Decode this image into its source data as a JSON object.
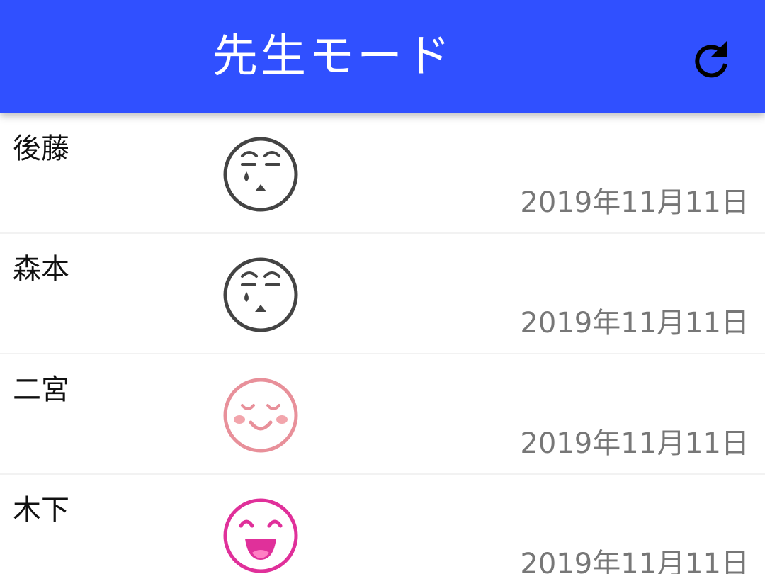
{
  "app_bar": {
    "title": "先生モード",
    "refresh_icon": "refresh-icon",
    "color": "#3050ff"
  },
  "list": {
    "rows": [
      {
        "name": "後藤",
        "mood_icon": "sad-tearful-face-icon",
        "mood_color": "#444444",
        "date": "2019年11月11日"
      },
      {
        "name": "森本",
        "mood_icon": "sad-tearful-face-icon",
        "mood_color": "#444444",
        "date": "2019年11月11日"
      },
      {
        "name": "二宮",
        "mood_icon": "content-smiling-face-icon",
        "mood_color": "#e8909a",
        "date": "2019年11月11日"
      },
      {
        "name": "木下",
        "mood_icon": "happy-laughing-face-icon",
        "mood_color": "#e0309a",
        "date": "2019年11月11日"
      }
    ]
  }
}
